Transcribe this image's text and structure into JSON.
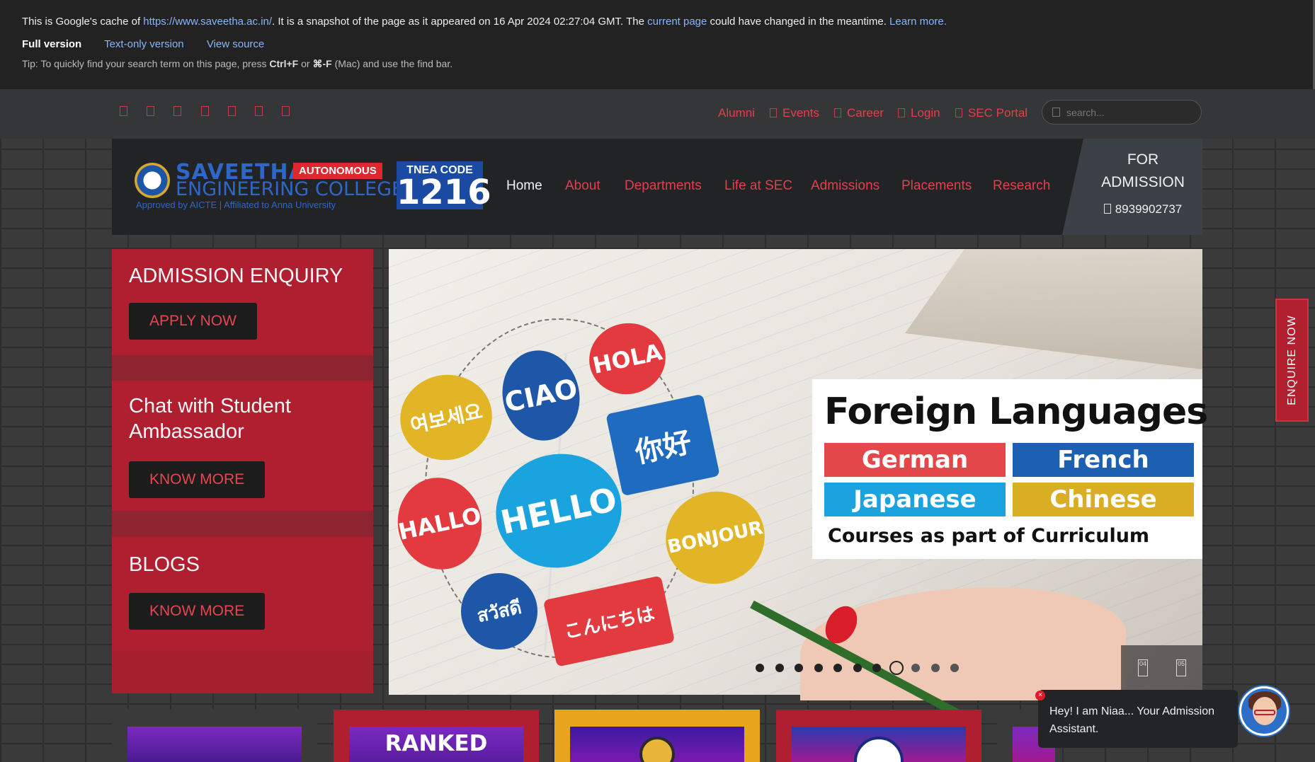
{
  "cache_banner": {
    "prefix": "This is Google's cache of ",
    "url": "https://www.saveetha.ac.in/",
    "middle": ". It is a snapshot of the page as it appeared on 16 Apr 2024 02:27:04 GMT. The ",
    "current_page": "current page",
    "suffix": " could have changed in the meantime. ",
    "learn_more": "Learn more.",
    "full_version": "Full version",
    "text_only": "Text-only version",
    "view_source": "View source",
    "tip_prefix": "Tip: To quickly find your search term on this page, press ",
    "tip_key1": "Ctrl+F",
    "tip_or": " or ",
    "tip_key2": "⌘-F",
    "tip_suffix": " (Mac) and use the find bar."
  },
  "social_icons": [
    "facebook-icon",
    "twitter-icon",
    "instagram-icon",
    "linkedin-icon",
    "youtube-icon",
    "pinterest-icon",
    "whatsapp-icon"
  ],
  "top_links": [
    "Alumni",
    "Events",
    "Career",
    "Login",
    "SEC Portal"
  ],
  "search": {
    "placeholder": "search..."
  },
  "logo": {
    "name1": "SAVEETHA",
    "name2": "ENGINEERING COLLEGE",
    "tag": "AUTONOMOUS",
    "sub": "Approved by AICTE  |  Affiliated to Anna University",
    "tnea_label": "TNEA CODE",
    "tnea_code": "1216"
  },
  "nav": [
    "Home",
    "About",
    "Departments",
    "Life at SEC",
    "Admissions",
    "Placements",
    "Research"
  ],
  "admission_box": {
    "line1": "FOR",
    "line2": "ADMISSION",
    "phone": "8939902737"
  },
  "left_panel": {
    "enquiry_title": "ADMISSION ENQUIRY",
    "apply_button": "APPLY NOW",
    "chat_title": "Chat with Student Ambassador",
    "chat_button": "KNOW MORE",
    "blogs_title": "BLOGS",
    "blogs_button": "KNOW MORE"
  },
  "slider": {
    "bubbles": [
      "여보세요",
      "CIAO",
      "HOLA",
      "你好",
      "HALLO",
      "HELLO",
      "BONJOUR",
      "สวัสดี",
      "こんにちは"
    ],
    "title": "Foreign Languages",
    "languages": [
      "German",
      "French",
      "Japanese",
      "Chinese"
    ],
    "subtitle": "Courses as part of Curriculum",
    "dot_count": 11,
    "active_dot": 8,
    "ctrl_prev": "04",
    "ctrl_next": "05"
  },
  "enquire_tab": "ENQUIRE NOW",
  "cards": [
    "",
    "RANKED",
    "",
    "",
    ""
  ],
  "chat_widget": {
    "message": "Hey! I am Niaa... Your Admission Assistant."
  },
  "colors": {
    "accent_red": "#e0404e",
    "panel_red": "#b01f30",
    "header_dark": "#222324",
    "brand_blue": "#2f66c9"
  }
}
